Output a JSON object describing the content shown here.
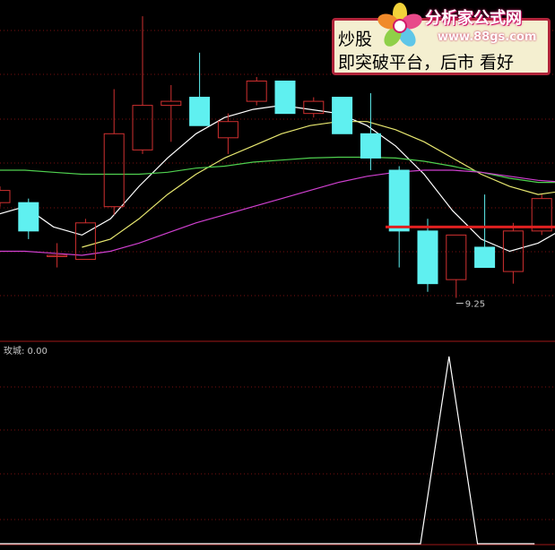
{
  "annotation": {
    "line1": "炒股",
    "line2": "即突破平台，后市 看好"
  },
  "watermark": {
    "title": "分析家公式网",
    "url": "www.88gs.com"
  },
  "indicator": {
    "label": "玫城: 0.00"
  },
  "chart_data": [
    {
      "type": "candlestick",
      "panel": "price",
      "candles": [
        {
          "o": 11.6,
          "c": 11.9,
          "h": 12.0,
          "l": 11.5
        },
        {
          "o": 11.6,
          "c": 10.9,
          "h": 11.7,
          "l": 10.7
        },
        {
          "o": 10.3,
          "c": 10.3,
          "h": 10.6,
          "l": 10.0
        },
        {
          "o": 10.2,
          "c": 11.1,
          "h": 11.2,
          "l": 10.2
        },
        {
          "o": 11.5,
          "c": 13.3,
          "h": 14.4,
          "l": 11.3
        },
        {
          "o": 12.9,
          "c": 14.0,
          "h": 16.2,
          "l": 12.8
        },
        {
          "o": 14.0,
          "c": 14.1,
          "h": 14.5,
          "l": 13.1
        },
        {
          "o": 14.2,
          "c": 13.5,
          "h": 15.3,
          "l": 13.5
        },
        {
          "o": 13.2,
          "c": 13.6,
          "h": 13.8,
          "l": 12.8
        },
        {
          "o": 14.1,
          "c": 14.6,
          "h": 14.7,
          "l": 14.0
        },
        {
          "o": 14.6,
          "c": 13.8,
          "h": 14.6,
          "l": 13.8
        },
        {
          "o": 13.8,
          "c": 14.1,
          "h": 14.2,
          "l": 13.7
        },
        {
          "o": 14.2,
          "c": 13.3,
          "h": 14.2,
          "l": 13.3
        },
        {
          "o": 13.3,
          "c": 12.7,
          "h": 14.3,
          "l": 12.4
        },
        {
          "o": 12.4,
          "c": 10.9,
          "h": 12.5,
          "l": 10.0
        },
        {
          "o": 10.9,
          "c": 9.6,
          "h": 11.2,
          "l": 9.4
        },
        {
          "o": 9.7,
          "c": 10.8,
          "h": 10.8,
          "l": 9.25
        },
        {
          "o": 10.5,
          "c": 10.0,
          "h": 11.8,
          "l": 10.0
        },
        {
          "o": 9.9,
          "c": 10.9,
          "h": 11.1,
          "l": 9.6
        },
        {
          "o": 10.9,
          "c": 11.7,
          "h": 11.8,
          "l": 10.8
        }
      ],
      "low_marker": {
        "text": "9.25",
        "value": 9.25,
        "index": 16
      },
      "moving_averages": [
        {
          "color": "#ffffff",
          "values": [
            11.3,
            11.5,
            11.0,
            10.8,
            11.2,
            12.0,
            12.7,
            13.3,
            13.7,
            13.9,
            14.0,
            13.9,
            13.8,
            13.5,
            13.0,
            12.3,
            11.4,
            10.7,
            10.4,
            10.6,
            11.0
          ]
        },
        {
          "color": "#e8e870",
          "values": [
            null,
            null,
            null,
            10.5,
            10.7,
            11.2,
            11.8,
            12.3,
            12.7,
            13.0,
            13.3,
            13.5,
            13.6,
            13.6,
            13.4,
            13.1,
            12.7,
            12.3,
            12.0,
            11.8,
            11.9
          ]
        },
        {
          "color": "#4fd04f",
          "values": [
            12.4,
            12.4,
            12.35,
            12.3,
            12.3,
            12.3,
            12.35,
            12.45,
            12.5,
            12.6,
            12.65,
            12.7,
            12.72,
            12.72,
            12.7,
            12.62,
            12.5,
            12.35,
            12.2,
            12.1,
            12.1
          ]
        },
        {
          "color": "#d040d0",
          "values": [
            10.4,
            10.4,
            10.35,
            10.3,
            10.4,
            10.6,
            10.85,
            11.1,
            11.3,
            11.5,
            11.7,
            11.9,
            12.1,
            12.25,
            12.35,
            12.4,
            12.4,
            12.35,
            12.25,
            12.15,
            12.1
          ]
        }
      ],
      "platform_line": {
        "color": "#e02020",
        "value": 11.0
      },
      "colors": {
        "up": "#d03030",
        "down": "#5ff0f0",
        "background": "#000000",
        "grid": "#7a1010"
      }
    },
    {
      "type": "line",
      "panel": "indicator",
      "series": [
        {
          "color": "#ffffff",
          "values": [
            0,
            0,
            0,
            0,
            0,
            0,
            0,
            0,
            0,
            0,
            0,
            0,
            0,
            0,
            0,
            0,
            1,
            0,
            0,
            0
          ]
        }
      ],
      "ylim": [
        0,
        1
      ]
    }
  ]
}
